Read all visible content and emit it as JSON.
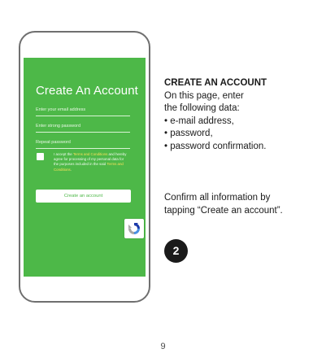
{
  "phone_screen": {
    "title": "Create An Account",
    "email_placeholder": "Enter your email address",
    "password_placeholder": "Enter strong password",
    "repeat_placeholder": "Repeat password",
    "terms": {
      "prefix": "I accept the ",
      "link1": "Terms and Conditions",
      "middle": " and hereby agree for processing of my personal data for the purposes included in the said ",
      "link2": "Terms and Conditions",
      "suffix": "."
    },
    "create_button_label": "Create an account",
    "recaptcha_icon": "recaptcha-icon",
    "colors": {
      "screen_bg": "#4db848",
      "link_highlight": "#f7e15a"
    }
  },
  "instructions": {
    "heading": "CREATE AN ACCOUNT",
    "lines": [
      "On this page, enter",
      "the following data:",
      "• e-mail address,",
      "• password,",
      "• password confirmation."
    ],
    "confirm_lines": [
      "Confirm all information by",
      "tapping “Create an account”."
    ],
    "step_number": "2"
  },
  "page_number": "9"
}
